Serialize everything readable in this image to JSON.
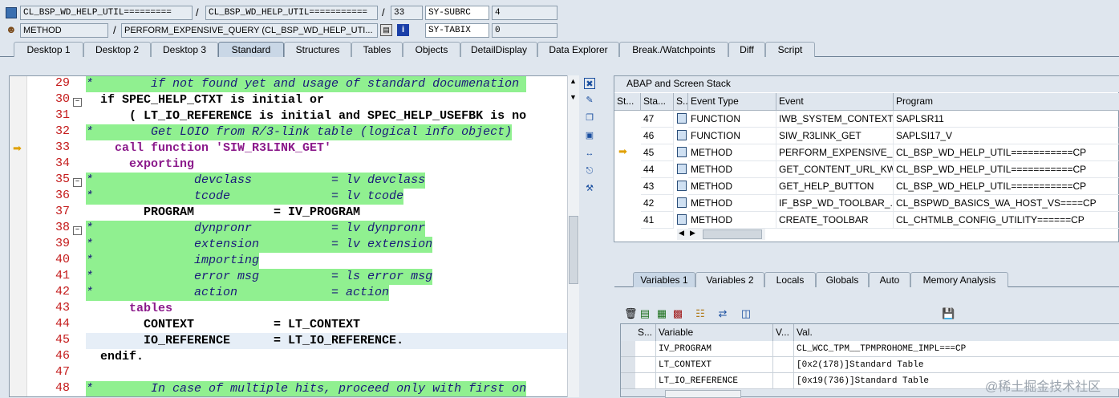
{
  "header": {
    "row1": {
      "class_name": "CL_BSP_WD_HELP_UTIL=========",
      "program": "CL_BSP_WD_HELP_UTIL===========",
      "line": "33",
      "sysvar": "SY-SUBRC",
      "sysval": "4"
    },
    "row2": {
      "event_type": "METHOD",
      "event": "PERFORM_EXPENSIVE_QUERY (CL_BSP_WD_HELP_UTI...",
      "sysvar": "SY-TABIX",
      "sysval": "0"
    },
    "slash": "/"
  },
  "tabs": [
    "Desktop 1",
    "Desktop 2",
    "Desktop 3",
    "Standard",
    "Structures",
    "Tables",
    "Objects",
    "DetailDisplay",
    "Data Explorer",
    "Break./Watchpoints",
    "Diff",
    "Script"
  ],
  "editor": {
    "lines": [
      {
        "n": "29",
        "text": "*        if not found yet and usage of standard documenation "
      },
      {
        "n": "30",
        "text": "  if SPEC_HELP_CTXT is initial or"
      },
      {
        "n": "31",
        "text": "      ( LT_IO_REFERENCE is initial and SPEC_HELP_USEFBK is no"
      },
      {
        "n": "32",
        "text": "*        Get LOIO from R/3-link table (logical info object)"
      },
      {
        "n": "33",
        "text": "    call function 'SIW_R3LINK_GET'"
      },
      {
        "n": "34",
        "text": "      exporting"
      },
      {
        "n": "35",
        "text": "*              devclass           = lv devclass"
      },
      {
        "n": "36",
        "text": "*              tcode              = lv tcode"
      },
      {
        "n": "37",
        "text": "        PROGRAM           = IV_PROGRAM"
      },
      {
        "n": "38",
        "text": "*              dynpronr           = lv dynpronr"
      },
      {
        "n": "39",
        "text": "*              extension          = lv extension"
      },
      {
        "n": "40",
        "text": "*              importing"
      },
      {
        "n": "41",
        "text": "*              error msg          = ls error msg"
      },
      {
        "n": "42",
        "text": "*              action             = action"
      },
      {
        "n": "43",
        "text": "      tables"
      },
      {
        "n": "44",
        "text": "        CONTEXT           = LT_CONTEXT"
      },
      {
        "n": "45",
        "text": "        IO_REFERENCE      = LT_IO_REFERENCE."
      },
      {
        "n": "46",
        "text": "  endif."
      },
      {
        "n": "47",
        "text": ""
      },
      {
        "n": "48",
        "text": "*        In case of multiple hits, proceed only with first on"
      }
    ]
  },
  "stack": {
    "title": "ABAP and Screen Stack",
    "columns": [
      "St...",
      "Sta...",
      "S...",
      "Event Type",
      "Event",
      "Program"
    ],
    "rows": [
      {
        "level": "47",
        "event_type": "FUNCTION",
        "event": "IWB_SYSTEM_CONTEXT...",
        "program": "SAPLSR11",
        "current": false
      },
      {
        "level": "46",
        "event_type": "FUNCTION",
        "event": "SIW_R3LINK_GET",
        "program": "SAPLSI17_V",
        "current": false
      },
      {
        "level": "45",
        "event_type": "METHOD",
        "event": "PERFORM_EXPENSIVE_Q...",
        "program": "CL_BSP_WD_HELP_UTIL===========CP",
        "current": true
      },
      {
        "level": "44",
        "event_type": "METHOD",
        "event": "GET_CONTENT_URL_KW",
        "program": "CL_BSP_WD_HELP_UTIL===========CP",
        "current": false
      },
      {
        "level": "43",
        "event_type": "METHOD",
        "event": "GET_HELP_BUTTON",
        "program": "CL_BSP_WD_HELP_UTIL===========CP",
        "current": false
      },
      {
        "level": "42",
        "event_type": "METHOD",
        "event": "IF_BSP_WD_TOOLBAR_...",
        "program": "CL_BSPWD_BASICS_WA_HOST_VS====CP",
        "current": false
      },
      {
        "level": "41",
        "event_type": "METHOD",
        "event": "CREATE_TOOLBAR",
        "program": "CL_CHTMLB_CONFIG_UTILITY======CP",
        "current": false
      }
    ]
  },
  "var_tabs": [
    "Variables 1",
    "Variables 2",
    "Locals",
    "Globals",
    "Auto",
    "Memory Analysis"
  ],
  "variables": {
    "columns": [
      "S...",
      "Variable",
      "V...",
      "Val."
    ],
    "rows": [
      {
        "name": "IV_PROGRAM",
        "value": "CL_WCC_TPM__TPMPROHOME_IMPL===CP"
      },
      {
        "name": "LT_CONTEXT",
        "value": "[0x2(178)]Standard Table"
      },
      {
        "name": "LT_IO_REFERENCE",
        "value": "[0x19(736)]Standard Table"
      }
    ]
  },
  "watermark": "@稀土掘金技术社区"
}
